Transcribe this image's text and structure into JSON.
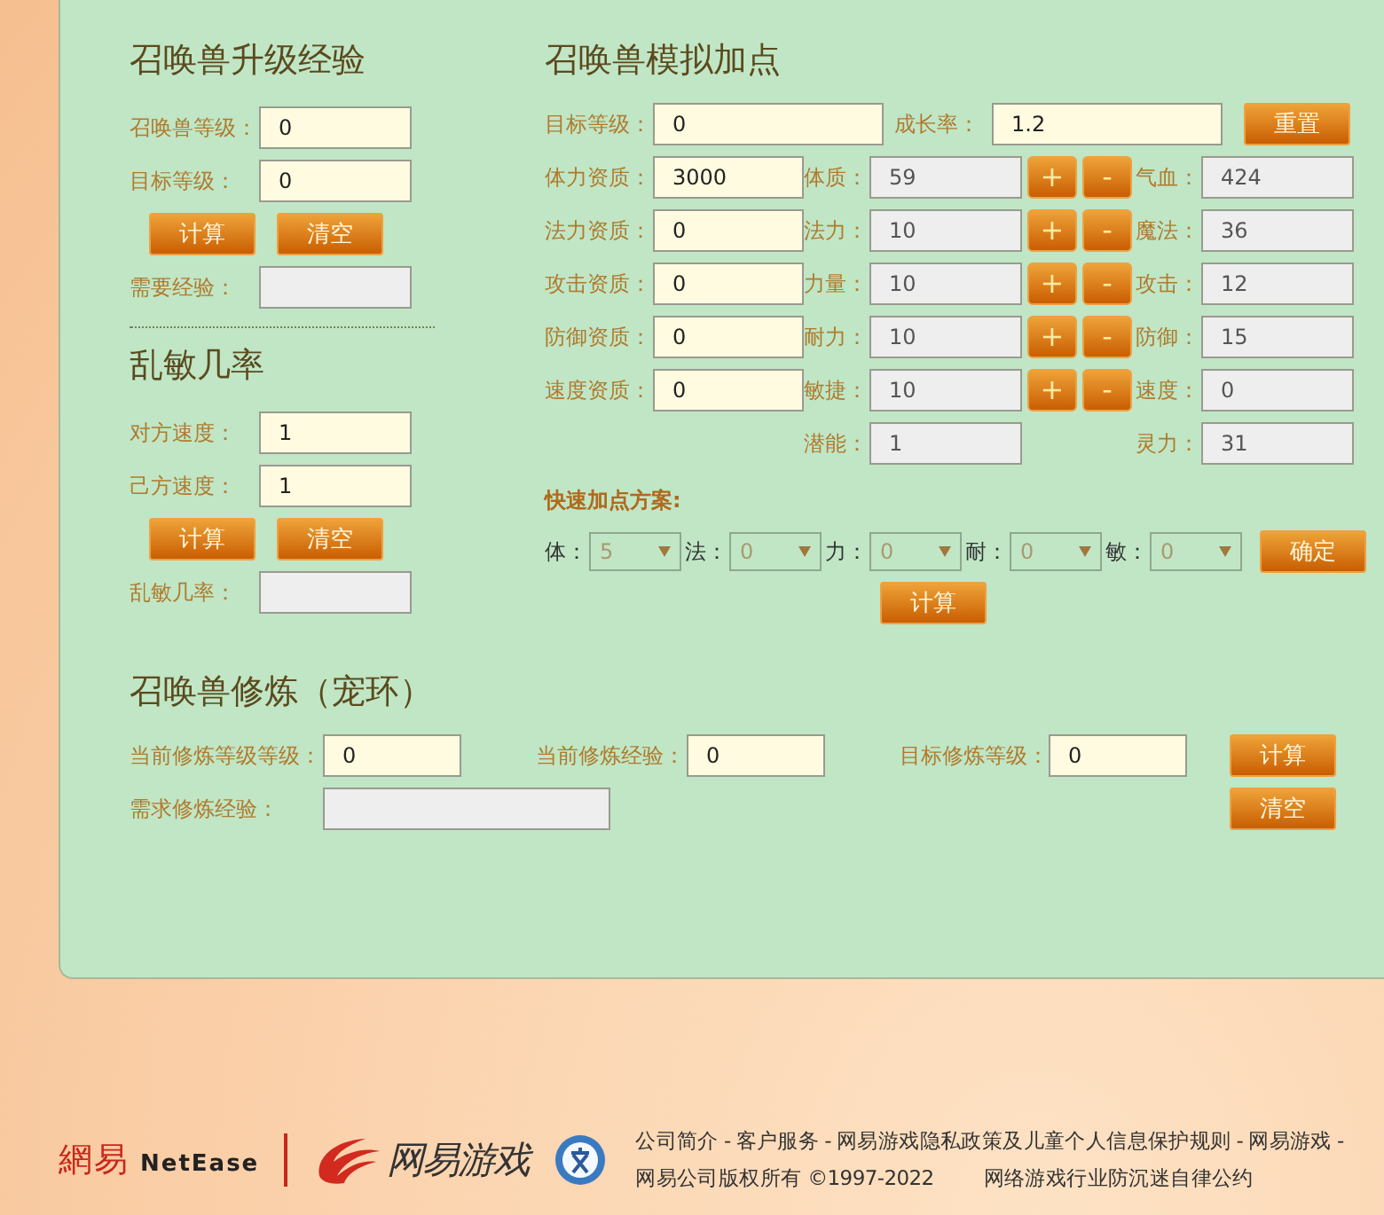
{
  "level_exp": {
    "title": "召唤兽升级经验",
    "fields": [
      {
        "label": "召唤兽等级：",
        "value": "0",
        "readonly": false
      },
      {
        "label": "目标等级：",
        "value": "0",
        "readonly": false
      }
    ],
    "buttons": [
      "计算",
      "清空"
    ],
    "result": {
      "label": "需要经验：",
      "readonly": true
    }
  },
  "speed_chance": {
    "title": "乱敏几率",
    "fields": [
      {
        "label": "对方速度：",
        "value": "1",
        "readonly": false
      },
      {
        "label": "己方速度：",
        "value": "1",
        "readonly": false
      }
    ],
    "buttons": [
      "计算",
      "清空"
    ],
    "result": {
      "label": "乱敏几率：",
      "readonly": true
    }
  },
  "simulator": {
    "title": "召唤兽模拟加点",
    "target_level": {
      "label": "目标等级：",
      "value": "0"
    },
    "growth": {
      "label": "成长率：",
      "value": "1.2"
    },
    "reset_button": "重置",
    "rows": [
      {
        "aptitude": {
          "label": "体力资质：",
          "value": "3000"
        },
        "attribute": {
          "label": "体质：",
          "value": "59"
        },
        "plus": "+",
        "minus": "-",
        "derived": {
          "label": "气血：",
          "value": "424"
        }
      },
      {
        "aptitude": {
          "label": "法力资质：",
          "value": "0"
        },
        "attribute": {
          "label": "法力：",
          "value": "10"
        },
        "plus": "+",
        "minus": "-",
        "derived": {
          "label": "魔法：",
          "value": "36"
        }
      },
      {
        "aptitude": {
          "label": "攻击资质：",
          "value": "0"
        },
        "attribute": {
          "label": "力量：",
          "value": "10"
        },
        "plus": "+",
        "minus": "-",
        "derived": {
          "label": "攻击：",
          "value": "12"
        }
      },
      {
        "aptitude": {
          "label": "防御资质：",
          "value": "0"
        },
        "attribute": {
          "label": "耐力：",
          "value": "10"
        },
        "plus": "+",
        "minus": "-",
        "derived": {
          "label": "防御：",
          "value": "15"
        }
      },
      {
        "aptitude": {
          "label": "速度资质：",
          "value": "0"
        },
        "attribute": {
          "label": "敏捷：",
          "value": "10"
        },
        "plus": "+",
        "minus": "-",
        "derived": {
          "label": "速度：",
          "value": "0"
        }
      },
      {
        "attribute": {
          "label": "潜能：",
          "value": "1"
        },
        "derived": {
          "label": "灵力：",
          "value": "31"
        }
      }
    ],
    "quick_plan": {
      "title": "快速加点方案:",
      "selects": [
        {
          "label": "体：",
          "value": "5"
        },
        {
          "label": "法：",
          "value": "0"
        },
        {
          "label": "力：",
          "value": "0"
        },
        {
          "label": "耐：",
          "value": "0"
        },
        {
          "label": "敏：",
          "value": "0"
        }
      ],
      "confirm_button": "确定",
      "calc_button": "计算"
    }
  },
  "training": {
    "title": "召唤兽修炼（宠环）",
    "fields": [
      {
        "label": "当前修炼等级等级：",
        "value": "0"
      },
      {
        "label": "当前修炼经验：",
        "value": "0"
      },
      {
        "label": "目标修炼等级：",
        "value": "0"
      }
    ],
    "result": {
      "label": "需求修炼经验："
    },
    "buttons": [
      "计算",
      "清空"
    ]
  },
  "footer": {
    "netease_logo": [
      "網易",
      "NetEase"
    ],
    "games_logo": "网易游戏",
    "links": [
      "公司简介",
      "客户服务",
      "网易游戏隐私政策及儿童个人信息保护规则",
      "网易游戏"
    ],
    "separator": "-",
    "copyright": "网易公司版权所有 ©1997-2022",
    "pledge": "网络游戏行业防沉迷自律公约"
  }
}
